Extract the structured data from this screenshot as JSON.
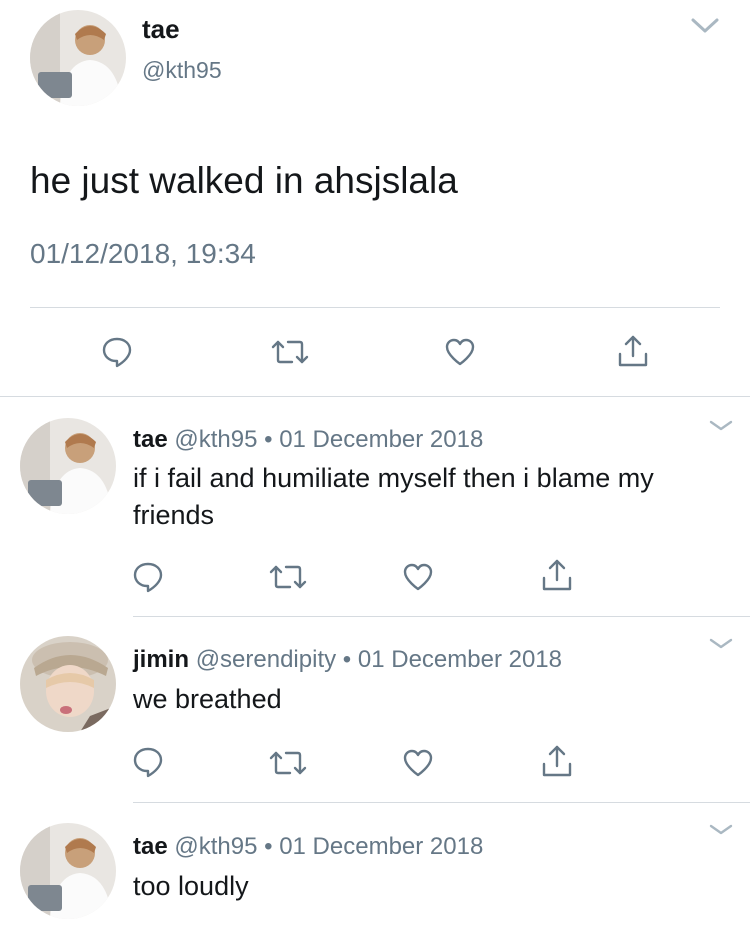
{
  "main_tweet": {
    "name": "tae",
    "handle": "@kth95",
    "text": "he just walked in ahsjslala",
    "timestamp": "01/12/2018, 19:34"
  },
  "replies": [
    {
      "name": "tae",
      "handle": "@kth95",
      "separator": "•",
      "date": "01 December 2018",
      "text_line1": "if i fail and humiliate myself then i blame my",
      "text_line2": "friends"
    },
    {
      "name": "jimin",
      "handle": "@serendipity",
      "separator": "•",
      "date": "01 December 2018",
      "text_line1": "we breathed"
    },
    {
      "name": "tae",
      "handle": "@kth95",
      "separator": "•",
      "date": "01 December 2018",
      "text_line1": "too loudly"
    }
  ],
  "icons": {
    "reply": "speech-bubble",
    "retweet": "retweet-arrows",
    "like": "heart-outline",
    "share": "share-upload",
    "menu": "chevron-down"
  },
  "colors": {
    "text": "#14171a",
    "muted": "#657786",
    "divider": "#d6dbe0"
  }
}
